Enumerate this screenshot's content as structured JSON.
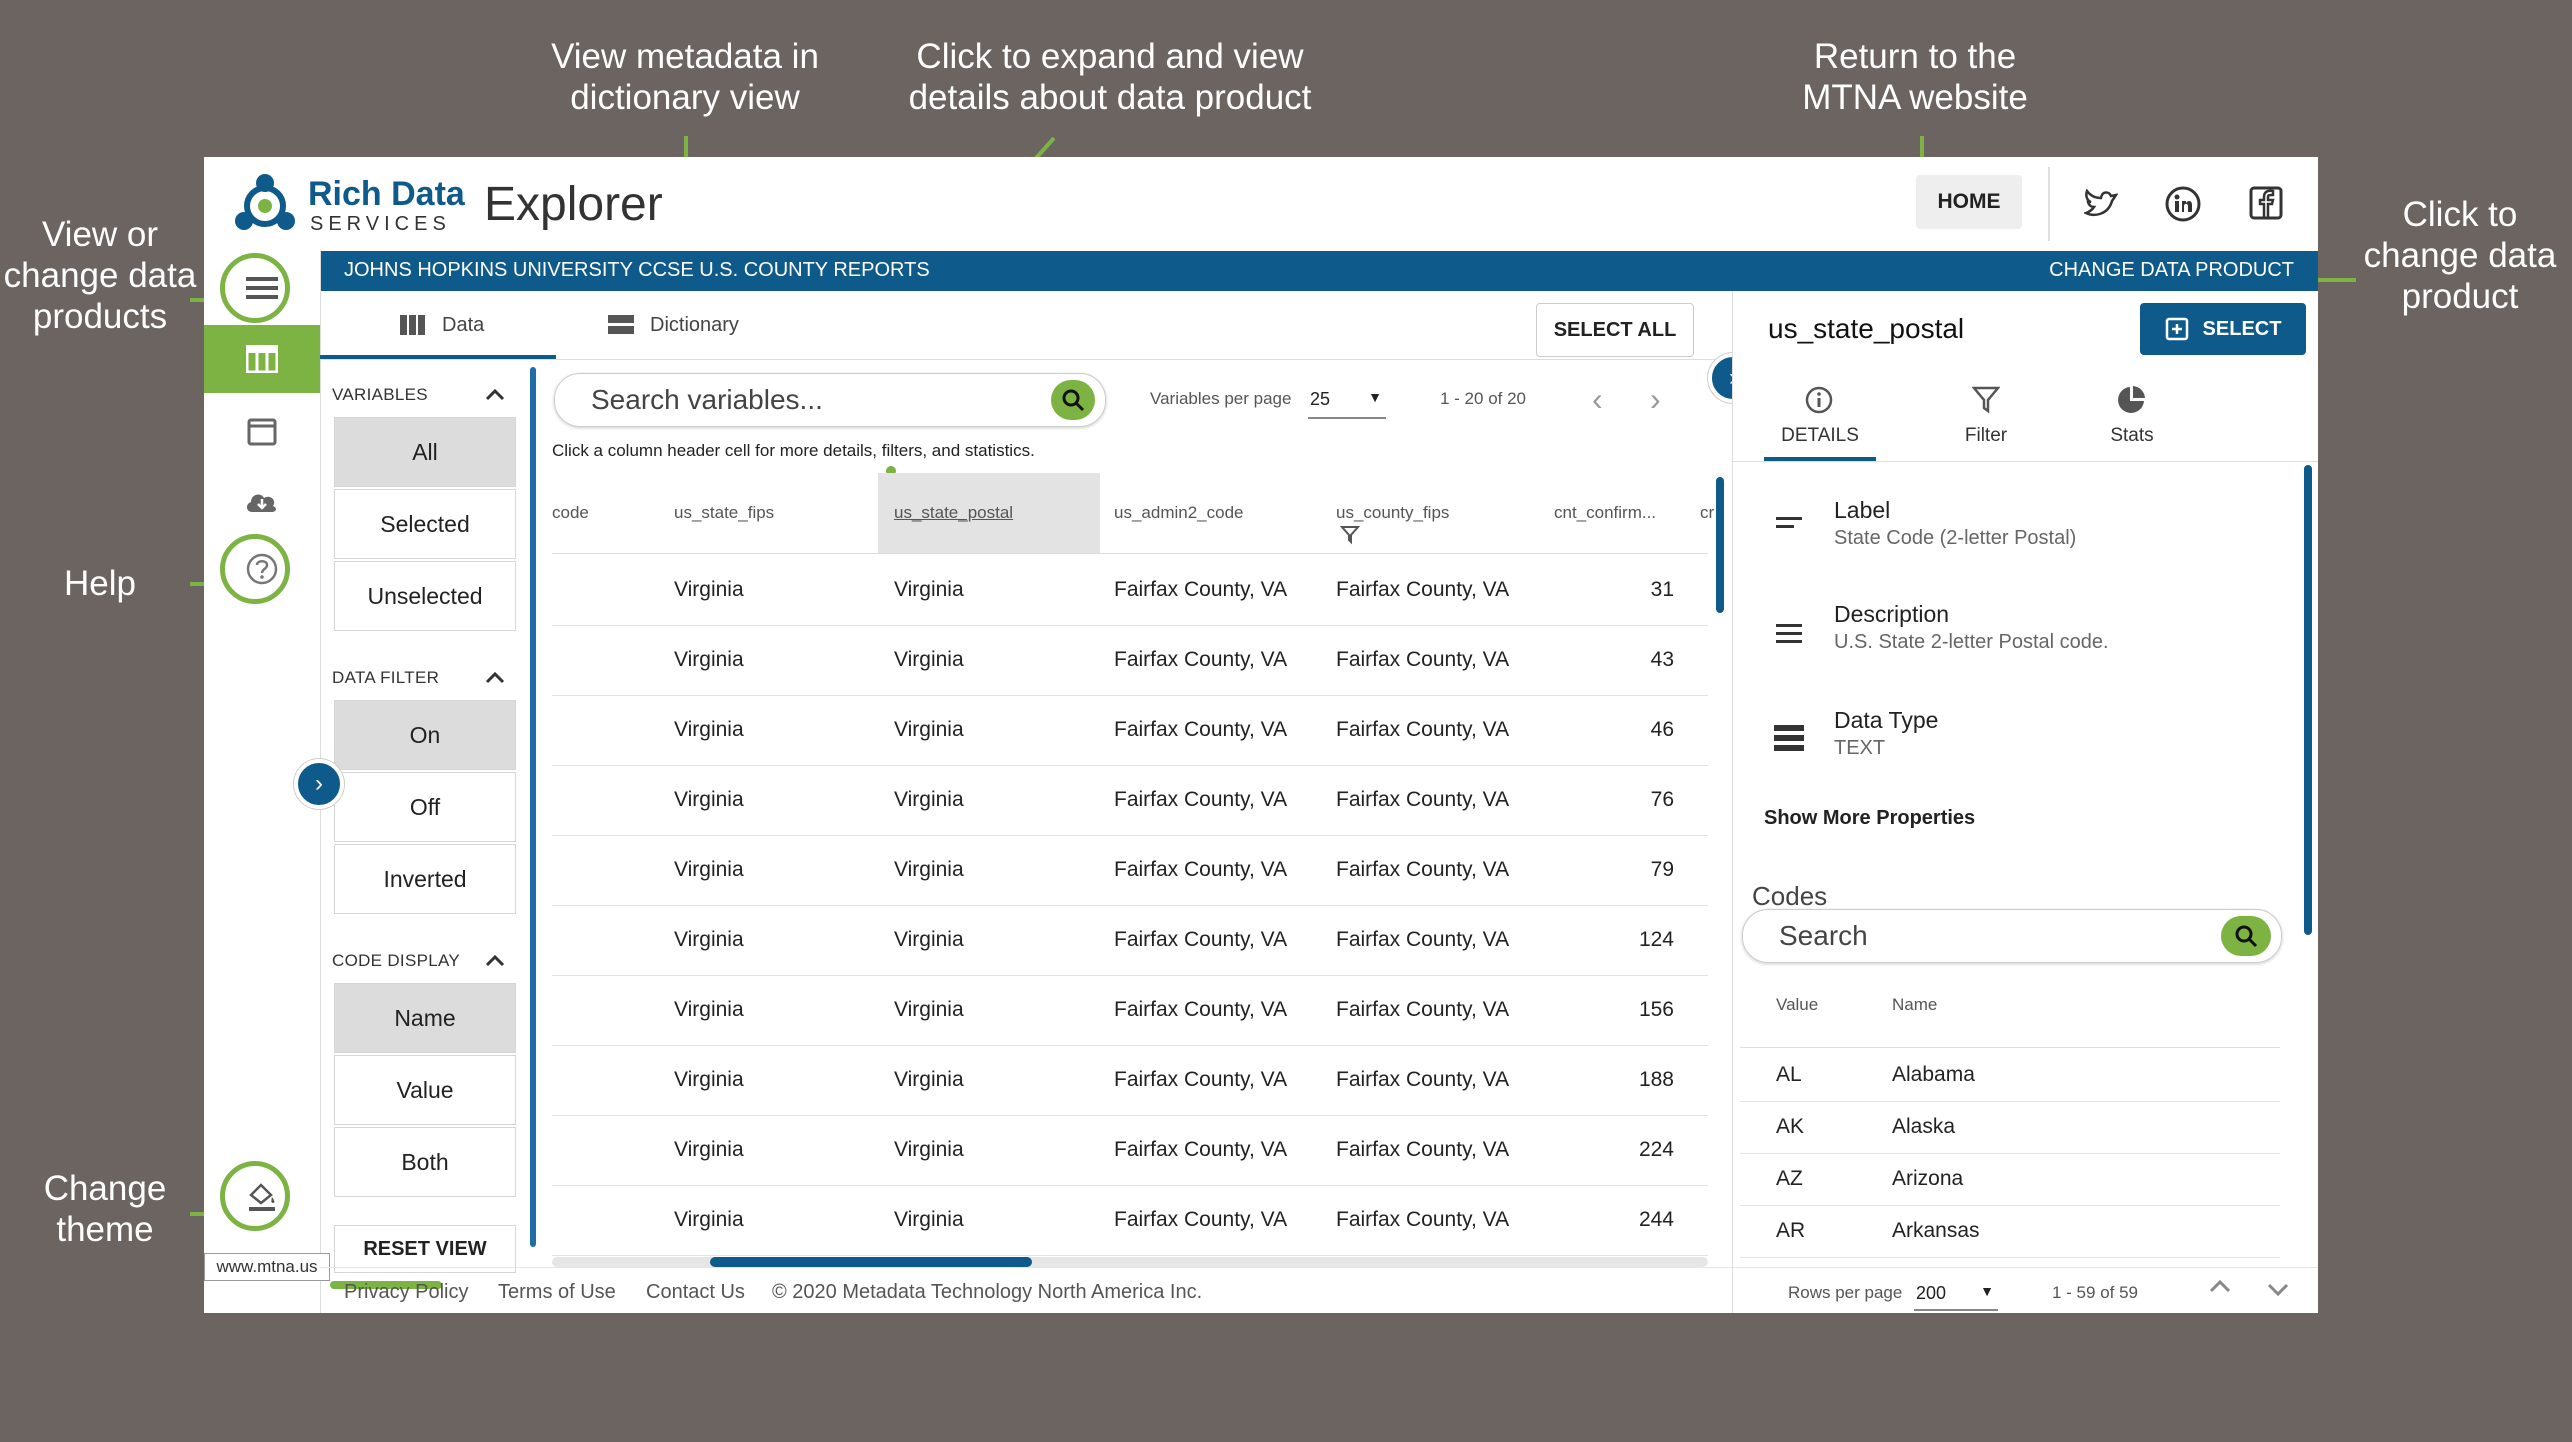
{
  "callouts": {
    "dictionary": "View metadata in\ndictionary view",
    "expand": "Click to expand and view\ndetails about data product",
    "mtna": "Return to the\nMTNA website",
    "view_products": "View or\nchange data\nproducts",
    "help": "Help",
    "theme": "Change\ntheme",
    "change_product": "Click to\nchange data\nproduct"
  },
  "brand": {
    "name_line1": "Rich Data",
    "name_line2": "SERVICES",
    "app_title": "Explorer"
  },
  "header": {
    "home_label": "HOME",
    "icons": [
      "twitter-icon",
      "linkedin-icon",
      "facebook-icon"
    ]
  },
  "product_bar": {
    "title": "JOHNS HOPKINS UNIVERSITY CCSE U.S. COUNTY REPORTS",
    "change_label": "CHANGE DATA PRODUCT"
  },
  "tabs": {
    "data": "Data",
    "dictionary": "Dictionary",
    "select_all": "SELECT ALL"
  },
  "sidebar": {
    "variables_title": "VARIABLES",
    "variables_options": [
      "All",
      "Selected",
      "Unselected"
    ],
    "filter_title": "DATA FILTER",
    "filter_options": [
      "On",
      "Off",
      "Inverted"
    ],
    "code_title": "CODE DISPLAY",
    "code_options": [
      "Name",
      "Value",
      "Both"
    ],
    "reset_label": "RESET VIEW"
  },
  "search": {
    "placeholder": "Search variables...",
    "per_page_label": "Variables per page",
    "per_page_value": "25",
    "range": "1 - 20 of 20",
    "hint": "Click a column header cell for more details, filters, and statistics."
  },
  "columns": [
    "code",
    "us_state_fips",
    "us_state_postal",
    "us_admin2_code",
    "us_county_fips",
    "cnt_confirm...",
    "cr"
  ],
  "rows": [
    [
      "Virginia",
      "Virginia",
      "Fairfax County, VA",
      "Fairfax County, VA",
      "31"
    ],
    [
      "Virginia",
      "Virginia",
      "Fairfax County, VA",
      "Fairfax County, VA",
      "43"
    ],
    [
      "Virginia",
      "Virginia",
      "Fairfax County, VA",
      "Fairfax County, VA",
      "46"
    ],
    [
      "Virginia",
      "Virginia",
      "Fairfax County, VA",
      "Fairfax County, VA",
      "76"
    ],
    [
      "Virginia",
      "Virginia",
      "Fairfax County, VA",
      "Fairfax County, VA",
      "79"
    ],
    [
      "Virginia",
      "Virginia",
      "Fairfax County, VA",
      "Fairfax County, VA",
      "124"
    ],
    [
      "Virginia",
      "Virginia",
      "Fairfax County, VA",
      "Fairfax County, VA",
      "156"
    ],
    [
      "Virginia",
      "Virginia",
      "Fairfax County, VA",
      "Fairfax County, VA",
      "188"
    ],
    [
      "Virginia",
      "Virginia",
      "Fairfax County, VA",
      "Fairfax County, VA",
      "224"
    ],
    [
      "Virginia",
      "Virginia",
      "Fairfax County, VA",
      "Fairfax County, VA",
      "244"
    ]
  ],
  "detail": {
    "variable": "us_state_postal",
    "select_label": "SELECT",
    "tabs": [
      "DETAILS",
      "Filter",
      "Stats"
    ],
    "props": [
      {
        "label": "Label",
        "value": "State Code (2-letter Postal)"
      },
      {
        "label": "Description",
        "value": "U.S. State 2-letter Postal code."
      },
      {
        "label": "Data Type",
        "value": "TEXT"
      }
    ],
    "show_more": "Show More Properties",
    "codes_title": "Codes",
    "codes_search": "Search",
    "codes_headers": [
      "Value",
      "Name"
    ],
    "codes": [
      [
        "AL",
        "Alabama"
      ],
      [
        "AK",
        "Alaska"
      ],
      [
        "AZ",
        "Arizona"
      ],
      [
        "AR",
        "Arkansas"
      ]
    ]
  },
  "footer": {
    "links": [
      "Privacy Policy",
      "Terms of Use",
      "Contact Us"
    ],
    "copyright": "© 2020 Metadata Technology North America Inc.",
    "rows_label": "Rows per page",
    "rows_value": "200",
    "rows_range": "1 - 59 of 59",
    "tooltip": "www.mtna.us"
  },
  "colors": {
    "accent": "#7cb342",
    "brand_blue": "#0e5a8a",
    "background": "#6b6461"
  }
}
